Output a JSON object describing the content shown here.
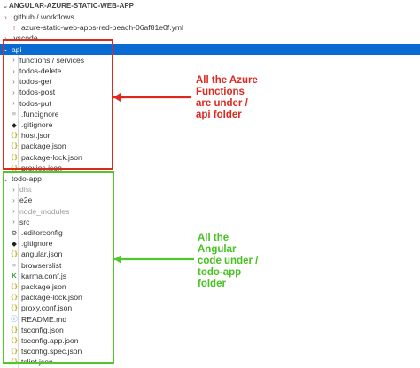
{
  "header": {
    "title": "ANGULAR-AZURE-STATIC-WEB-APP"
  },
  "rows": [
    {
      "label": ".github / workflows",
      "icon": "chevron",
      "chev": "›",
      "indent": 1,
      "muted": false
    },
    {
      "label": "azure-static-web-apps-red-beach-06af81e0f.yml",
      "icon": "yml-icon",
      "chev": "",
      "indent": 2,
      "muted": false
    },
    {
      "label": ".vscode",
      "icon": "chevron",
      "chev": "›",
      "indent": 1,
      "muted": false
    },
    {
      "label": "api",
      "icon": "chevron",
      "chev": "⌄",
      "indent": 1,
      "muted": false,
      "selected": true
    },
    {
      "label": "functions / services",
      "icon": "chevron",
      "chev": "›",
      "indent": 2,
      "muted": false
    },
    {
      "label": "todos-delete",
      "icon": "chevron",
      "chev": "›",
      "indent": 2,
      "muted": false
    },
    {
      "label": "todos-get",
      "icon": "chevron",
      "chev": "›",
      "indent": 2,
      "muted": false
    },
    {
      "label": "todos-post",
      "icon": "chevron",
      "chev": "›",
      "indent": 2,
      "muted": false
    },
    {
      "label": "todos-put",
      "icon": "chevron",
      "chev": "›",
      "indent": 2,
      "muted": false
    },
    {
      "label": ".funcignore",
      "icon": "file-icon",
      "chev": "",
      "indent": 2,
      "muted": false
    },
    {
      "label": ".gitignore",
      "icon": "git-icon",
      "chev": "",
      "indent": 2,
      "muted": false
    },
    {
      "label": "host.json",
      "icon": "json-icon",
      "chev": "",
      "indent": 2,
      "muted": false
    },
    {
      "label": "package.json",
      "icon": "json-icon",
      "chev": "",
      "indent": 2,
      "muted": false
    },
    {
      "label": "package-lock.json",
      "icon": "json-icon",
      "chev": "",
      "indent": 2,
      "muted": false
    },
    {
      "label": "proxies.json",
      "icon": "json-icon",
      "chev": "",
      "indent": 2,
      "muted": false
    },
    {
      "label": "todo-app",
      "icon": "chevron",
      "chev": "⌄",
      "indent": 1,
      "muted": false
    },
    {
      "label": "dist",
      "icon": "chevron",
      "chev": "›",
      "indent": 2,
      "muted": true
    },
    {
      "label": "e2e",
      "icon": "chevron",
      "chev": "›",
      "indent": 2,
      "muted": false
    },
    {
      "label": "node_modules",
      "icon": "chevron",
      "chev": "›",
      "indent": 2,
      "muted": true
    },
    {
      "label": "src",
      "icon": "chevron",
      "chev": "›",
      "indent": 2,
      "muted": false
    },
    {
      "label": ".editorconfig",
      "icon": "gear-icon",
      "chev": "",
      "indent": 2,
      "muted": false
    },
    {
      "label": ".gitignore",
      "icon": "git-icon",
      "chev": "",
      "indent": 2,
      "muted": false
    },
    {
      "label": "angular.json",
      "icon": "json-icon",
      "chev": "",
      "indent": 2,
      "muted": false
    },
    {
      "label": "browserslist",
      "icon": "file-icon",
      "chev": "",
      "indent": 2,
      "muted": false
    },
    {
      "label": "karma.conf.js",
      "icon": "karma-icon",
      "chev": "",
      "indent": 2,
      "muted": false
    },
    {
      "label": "package.json",
      "icon": "json-icon",
      "chev": "",
      "indent": 2,
      "muted": false
    },
    {
      "label": "package-lock.json",
      "icon": "json-icon",
      "chev": "",
      "indent": 2,
      "muted": false
    },
    {
      "label": "proxy.conf.json",
      "icon": "json-icon",
      "chev": "",
      "indent": 2,
      "muted": false
    },
    {
      "label": "README.md",
      "icon": "info-icon",
      "chev": "",
      "indent": 2,
      "muted": false
    },
    {
      "label": "tsconfig.json",
      "icon": "json-icon",
      "chev": "",
      "indent": 2,
      "muted": false
    },
    {
      "label": "tsconfig.app.json",
      "icon": "json-icon",
      "chev": "",
      "indent": 2,
      "muted": false
    },
    {
      "label": "tsconfig.spec.json",
      "icon": "json-icon",
      "chev": "",
      "indent": 2,
      "muted": false
    },
    {
      "label": "tslint.json",
      "icon": "json-icon",
      "chev": "",
      "indent": 2,
      "muted": false
    }
  ],
  "annotations": {
    "api_note": "All the Azure\nFunctions\nare under /\napi folder",
    "todo_note": "All the\nAngular\ncode under /\ntodo-app\nfolder"
  },
  "colors": {
    "selection": "#0b6ad1",
    "annotation_red": "#e0281f",
    "annotation_green": "#52c72b"
  }
}
